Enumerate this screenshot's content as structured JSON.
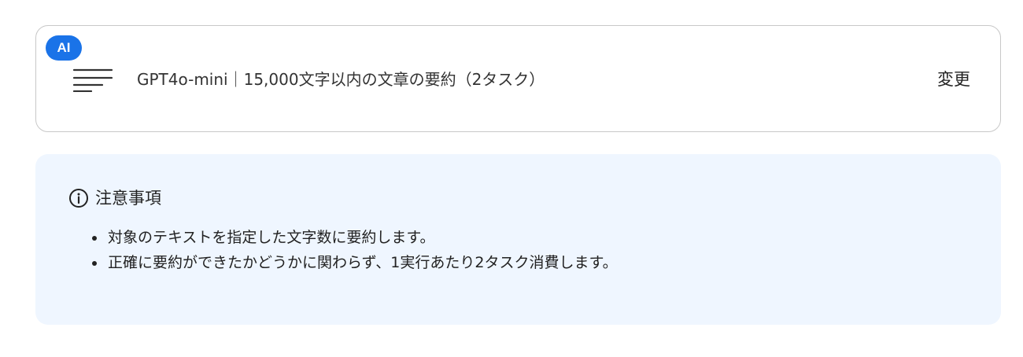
{
  "action": {
    "badge": "AI",
    "icon": "text-summary-icon",
    "label": "GPT4o-mini｜15,000文字以内の文章の要約（2タスク）",
    "change_label": "変更"
  },
  "notice": {
    "icon": "info-icon",
    "title": "注意事項",
    "items": [
      "対象のテキストを指定した文字数に要約します。",
      "正確に要約ができたかどうかに関わらず、1実行あたり2タスク消費します。"
    ]
  },
  "colors": {
    "badge": "#1a73e8",
    "notice_background": "#eff6ff",
    "card_border": "#c8c8c8"
  }
}
